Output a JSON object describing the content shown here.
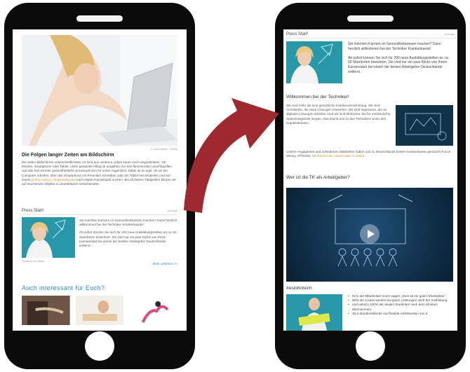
{
  "left_screen": {
    "hero_caption": "© fodor adele · fotolia",
    "title": "Die Folgen langer Zeiten am Bildschirm",
    "body_before_link": "Die vielen Bildschirme unterschiedlichster Art sind aus unserem Leben kaum noch wegzudenken. Ob Monitor, Smartphone oder Tablet, unser gesamter Alltag ist umgeben von den flimmernden Leuchtquellen und das hat mitunter gesundheitliche Konsequenzen für unser Augenlicht. Dabei ist es egal, ob wir am Computer Arbeiten, über das Smartphone mit Freunden schreiben oder am Tablet herumspielen und auf einem",
    "body_link": "Online Casino Vergleichsportal",
    "body_after_link": "nach etwas Freizeitspaß suchen. Bei all diesen Tätigkeiten blicken wir auf leuchtende Objekte in unmittelbarer Gesichtsnähe.",
    "press_start": {
      "heading": "Press Start!",
      "anzeige": "Anzeige",
      "para1": "Sie möchten Karriere im Gesundheitswesen machen? Dann herzlich willkommen bei der Techniker Krankenkasse!",
      "para2": "Ab sofort können Sie sich für 200 neue Ausbildungsstellen an ca. 50 Standorten bewerben. Sie sind nur ein paar Klicks von Ihrem Karrierestart bei einem der besten Arbeitgeber Deutschlands entfernt.",
      "powered": "Powered by plista",
      "more_link": "Mehr erfahren >>"
    },
    "also_heading": "Auch interessant für Euch?"
  },
  "right_screen": {
    "press_start": {
      "heading": "Press Start!",
      "anzeige": "Anzeige",
      "para1": "Sie möchten Karriere im Gesundheitswesen machen? Dann herzlich willkommen bei der Techniker Krankenkasse!",
      "para2": "Ab sofort können Sie sich für 200 neue Ausbildungsstellen an ca. 50 Standorten bewerben. Sie sind nur ein paar Klicks von Ihrem Karrierestart bei einem der besten Arbeitgeber Deutschlands entfernt."
    },
    "welcome_heading": "Willkommen bei der Techniker!",
    "welcome_body": "Wir sind mehr als eine gesetzliche Krankenversicherung. Wir sind Architekten, die neue Lösungen entwerfen. Wir sind Ingenieure, die an digitalen Lösungen arbeiten. Und wir sind Mediziner, die für medizinische Spitzenangebote sorgen. Das macht uns zu den Technikern unter den Krankenkassen.",
    "employees_text": "Unsere engagierten und zufriedenen Mitarbeiter haben uns zu Deutschlands bester Krankenkasse gemacht (Focus Money, 07/2019).",
    "employees_link": "Wir freuen uns, davon dass zu bleibt.",
    "tk_heading": "Wer ist die TK als Arbeitgeber?",
    "hashtag": "#eslohntsich",
    "bullets": [
      "91% der Mitarbeiter/-innen sagen: „Dies ist ein guter Arbeitsplatz.“",
      "90% der Azubis werden bei guten Leistungen nach der Ausbildung",
      "und nahezu 100% der dualen Studenten nach dem Studium übernommen.",
      "35,5 Stunden/Woche und flexible Arbeitszeiten von 6"
    ]
  },
  "colors": {
    "accent_blue": "#2b8fc9",
    "link_orange": "#e8892a",
    "arrow_red": "#9e2a2f",
    "teal": "#1f8a99",
    "phone_body": "#0b0b0b"
  }
}
